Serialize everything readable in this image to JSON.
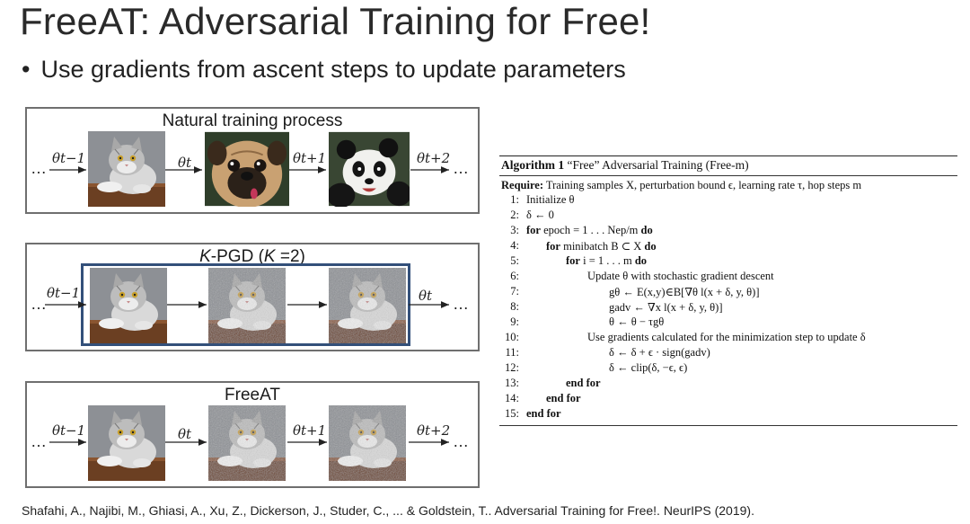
{
  "title": "FreeAT: Adversarial Training for Free!",
  "bullet": "Use gradients from ascent steps to update parameters",
  "natural": {
    "title": "Natural training process",
    "labels": [
      "θt−1",
      "θt",
      "θt+1",
      "θt+2"
    ],
    "ellipsis": "…"
  },
  "kpgd": {
    "title_k": "K",
    "title_rest": "-PGD (",
    "title_k2": "K",
    "title_end": " =2)",
    "labels": [
      "θt−1",
      "θt"
    ],
    "ellipsis": "…"
  },
  "freeat": {
    "title": "FreeAT",
    "labels": [
      "θt−1",
      "θt",
      "θt+1",
      "θt+2"
    ],
    "ellipsis": "…"
  },
  "algorithm": {
    "header_bold": "Algorithm 1",
    "header_rest": " “Free” Adversarial Training (Free-m)",
    "require_bold": "Require:",
    "require_rest": " Training samples X, perturbation bound ϵ, learning rate τ, hop steps m",
    "lines": [
      {
        "num": "1:",
        "text": "Initialize θ"
      },
      {
        "num": "2:",
        "text": "δ ← 0"
      },
      {
        "num": "3:",
        "kw": "for",
        "text": " epoch = 1 . . . Nep/m ",
        "kw2": "do"
      },
      {
        "num": "4:",
        "kw": "for",
        "text": " minibatch B ⊂ X ",
        "kw2": "do"
      },
      {
        "num": "5:",
        "kw": "for",
        "text": " i = 1 . . . m ",
        "kw2": "do"
      },
      {
        "num": "6:",
        "text": "Update θ with stochastic gradient descent"
      },
      {
        "num": "7:",
        "text": "gθ ← E(x,y)∈B[∇θ l(x + δ, y, θ)]"
      },
      {
        "num": "8:",
        "text": "gadv ← ∇x l(x + δ, y, θ)]"
      },
      {
        "num": "9:",
        "text": "θ ← θ − τgθ"
      },
      {
        "num": "10:",
        "text": "Use gradients calculated for the minimization step to update δ"
      },
      {
        "num": "11:",
        "text": "δ ← δ + ϵ · sign(gadv)"
      },
      {
        "num": "12:",
        "text": "δ ← clip(δ, −ϵ, ϵ)"
      },
      {
        "num": "13:",
        "kw": "end for"
      },
      {
        "num": "14:",
        "kw": "end for"
      },
      {
        "num": "15:",
        "kw": "end for"
      }
    ]
  },
  "footer": "Shafahi, A., Najibi, M., Ghiasi, A., Xu, Z., Dickerson, J., Studer, C., ... & Goldstein, T.. Adversarial Training for Free!. NeurIPS (2019)."
}
